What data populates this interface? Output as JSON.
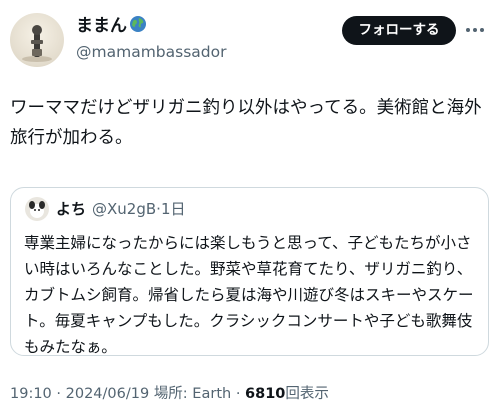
{
  "author": {
    "display_name": "ままん",
    "handle": "@mamambassador"
  },
  "follow_label": "フォローする",
  "tweet_text": "ワーママだけどザリガニ釣り以外はやってる。美術館と海外旅行が加わる。",
  "quoted": {
    "display_name": "よち",
    "handle": "@Xu2gB",
    "separator": "·",
    "age": "1日",
    "text": "専業主婦になったからには楽しもうと思って、子どもたちが小さい時はいろんなことした。野菜や草花育てたり、ザリガニ釣り、カブトムシ飼育。帰省したら夏は海や川遊び冬はスキーやスケート。毎夏キャンプもした。クラシックコンサートや子ども歌舞伎もみたなぁ。"
  },
  "meta": {
    "time": "19:10",
    "sep1": "·",
    "date": "2024/06/19",
    "location": "場所: Earth",
    "sep2": "·",
    "views_count": "6810",
    "views_label": "回表示"
  },
  "icons": [
    "globe-icon",
    "more-icon"
  ],
  "colors": {
    "text": "#0f1419",
    "secondary": "#536471",
    "border": "#cfd9de",
    "button_bg": "#0f1419"
  }
}
